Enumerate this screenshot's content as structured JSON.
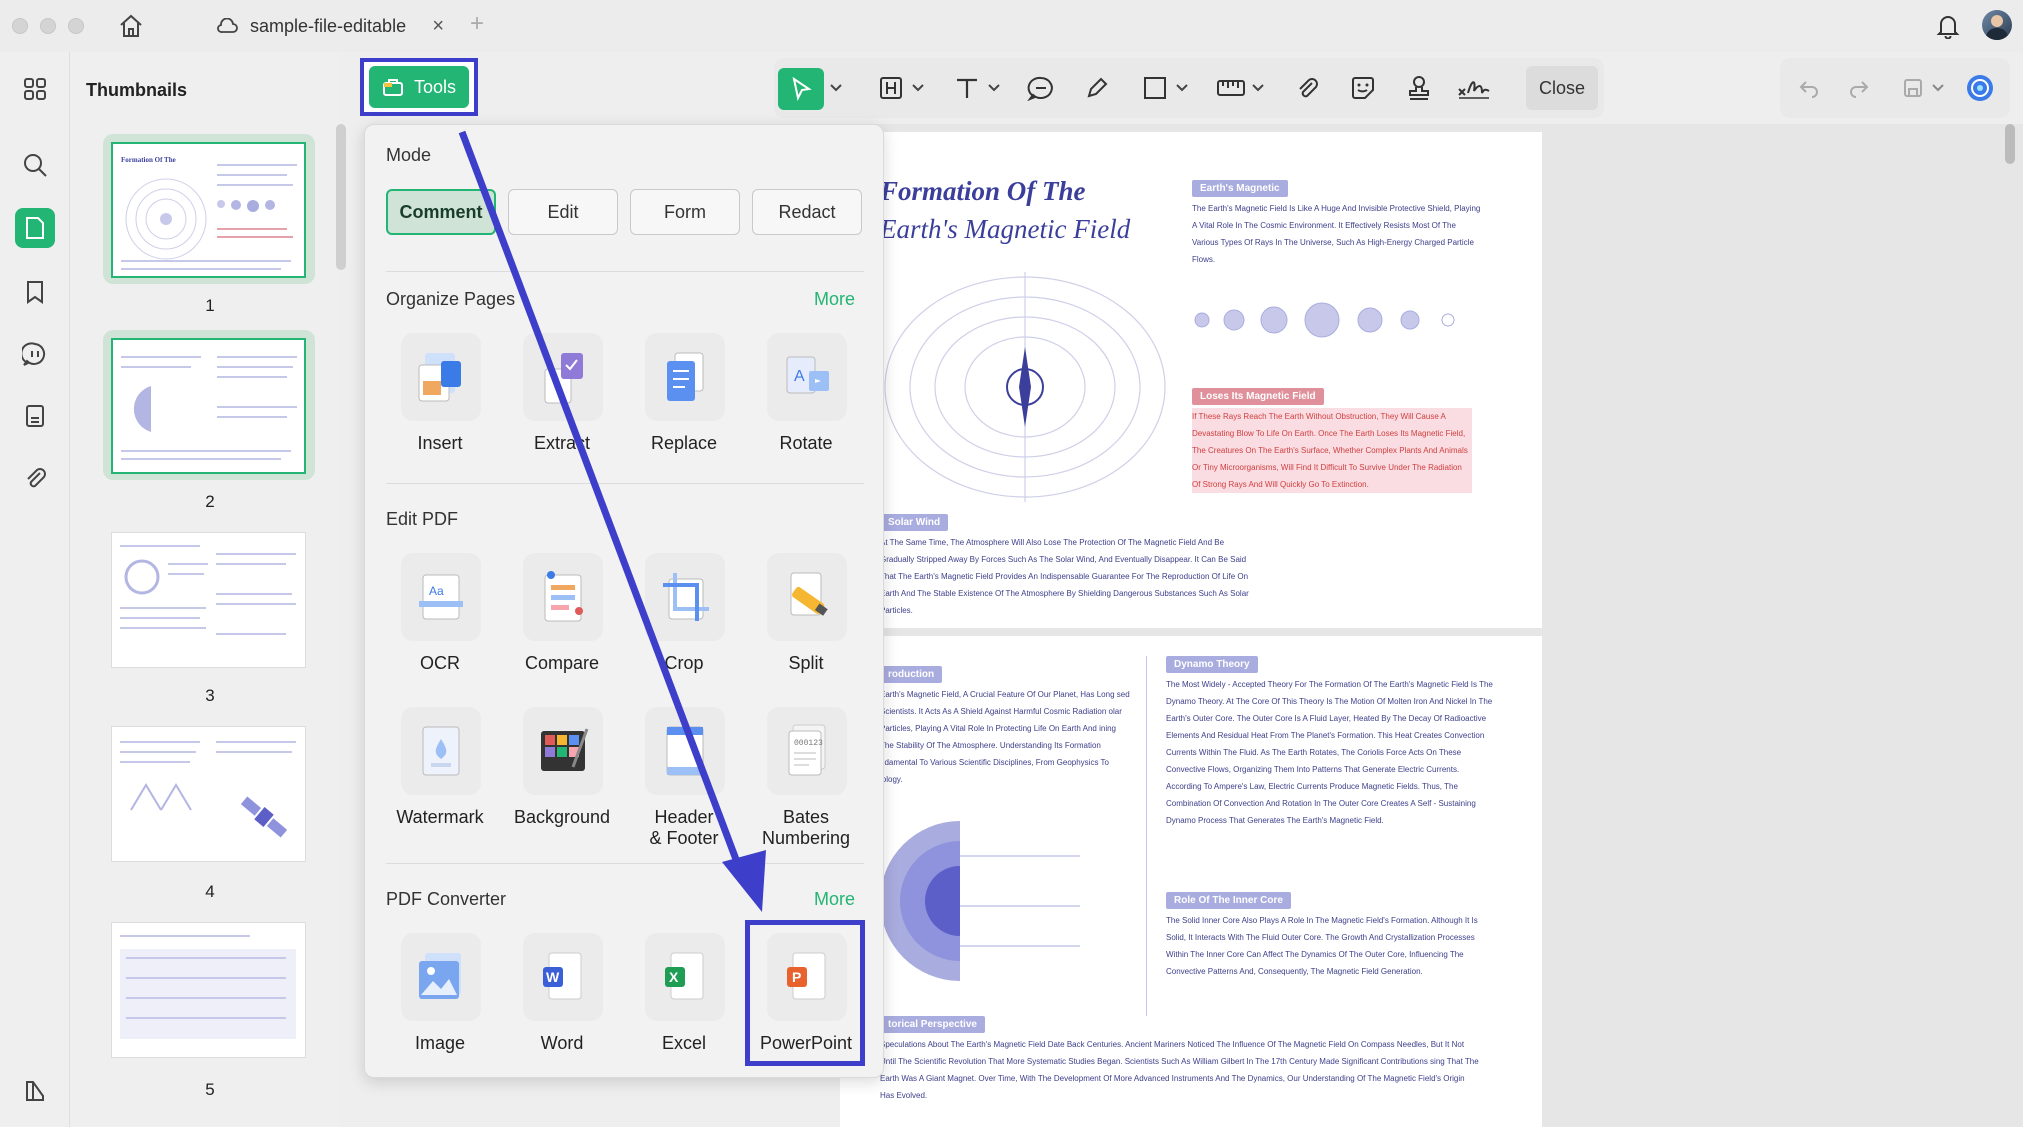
{
  "titlebar": {
    "tab_title": "sample-file-editable",
    "tab_close": "×",
    "new_tab": "+"
  },
  "thumbnails": {
    "heading": "Thumbnails",
    "pages": [
      {
        "number": "1",
        "selected": true
      },
      {
        "number": "2",
        "selected": true
      },
      {
        "number": "3",
        "selected": false
      },
      {
        "number": "4",
        "selected": false
      },
      {
        "number": "5",
        "selected": false
      }
    ]
  },
  "tools_button": {
    "label": "Tools"
  },
  "toolbar": {
    "close_label": "Close"
  },
  "panel": {
    "mode": {
      "title": "Mode",
      "buttons": [
        "Comment",
        "Edit",
        "Form",
        "Redact"
      ],
      "active": "Comment"
    },
    "organize": {
      "title": "Organize Pages",
      "more": "More",
      "items": [
        "Insert",
        "Extract",
        "Replace",
        "Rotate"
      ]
    },
    "edit": {
      "title": "Edit PDF",
      "items": [
        "OCR",
        "Compare",
        "Crop",
        "Split",
        "Watermark",
        "Background",
        "Header\n& Footer",
        "Bates\nNumbering"
      ]
    },
    "converter": {
      "title": "PDF Converter",
      "more": "More",
      "items": [
        "Image",
        "Word",
        "Excel",
        "PowerPoint"
      ]
    }
  },
  "document": {
    "page1": {
      "title_line1": "Formation Of The",
      "title_line2": "Earth's Magnetic Field",
      "chip_magnetic": "Earth's Magnetic",
      "chip_loses": "Loses Its Magnetic Field",
      "chip_solar": "Solar Wind",
      "text_magnetic": "The Earth's Magnetic Field Is Like A Huge And Invisible Protective Shield, Playing A Vital Role In The Cosmic Environment. It Effectively Resists Most Of The Various Types Of Rays In The Universe, Such As High-Energy Charged Particle Flows.",
      "text_loses": "If These Rays Reach The Earth Without Obstruction, They Will Cause A Devastating Blow To Life On Earth. Once The Earth Loses Its Magnetic Field, The Creatures On The Earth's Surface, Whether Complex Plants And Animals Or Tiny Microorganisms, Will Find It Difficult To Survive Under The Radiation Of Strong Rays And Will Quickly Go To Extinction.",
      "text_solar": "At The Same Time, The Atmosphere Will Also Lose The Protection Of The Magnetic Field And Be Gradually Stripped Away By Forces Such As The Solar Wind, And Eventually Disappear. It Can Be Said That The Earth's Magnetic Field Provides An Indispensable Guarantee For The Reproduction Of Life On Earth And The Stable Existence Of The Atmosphere By Shielding Dangerous Substances Such As Solar Particles."
    },
    "page2": {
      "chip_intro": "roduction",
      "chip_dynamo": "Dynamo Theory",
      "chip_inner": "Role Of The Inner Core",
      "chip_hist": "torical Perspective",
      "text_intro": "Earth's Magnetic Field, A Crucial Feature Of Our Planet, Has Long sed Scientists. It Acts As A Shield Against Harmful Cosmic Radiation olar Particles, Playing A Vital Role In Protecting Life On Earth And ining The Stability Of The Atmosphere. Understanding Its Formation ndamental To Various Scientific Disciplines, From Geophysics To iology.",
      "text_dynamo": "The Most Widely - Accepted Theory For The Formation Of The Earth's Magnetic Field Is The Dynamo Theory. At The Core Of This Theory Is The Motion Of Molten Iron And Nickel In The Earth's Outer Core. The Outer Core Is A Fluid Layer, Heated By The Decay Of Radioactive Elements And Residual Heat From The Planet's Formation. This Heat Creates Convection Currents Within The Fluid. As The Earth Rotates, The Coriolis Force Acts On These Convective Flows, Organizing Them Into Patterns That Generate Electric Currents. According To Ampere's Law, Electric Currents Produce Magnetic Fields. Thus, The Combination Of Convection And Rotation In The Outer Core Creates A Self - Sustaining Dynamo Process That Generates The Earth's Magnetic Field.",
      "text_inner": "The Solid Inner Core Also Plays A Role In The Magnetic Field's Formation. Although It Is Solid, It Interacts With The Fluid Outer Core. The Growth And Crystallization Processes Within The Inner Core Can Affect The Dynamics Of The Outer Core, Influencing The Convective Patterns And, Consequently, The Magnetic Field Generation.",
      "text_hist": "Speculations About The Earth's Magnetic Field Date Back Centuries. Ancient Mariners Noticed The Influence Of The Magnetic Field On Compass Needles, But It Not Until The Scientific Revolution That More Systematic Studies Began. Scientists Such As William Gilbert In The 17th Century Made Significant Contributions sing That The Earth Was A Giant Magnet. Over Time, With The Development Of More Advanced Instruments And The Dynamics, Our Understanding Of The Magnetic Field's Origin Has Evolved."
    }
  },
  "colors": {
    "accent_green": "#22b573",
    "highlight_blue": "#3d3ec9",
    "doc_purple": "#3b3f9b"
  }
}
